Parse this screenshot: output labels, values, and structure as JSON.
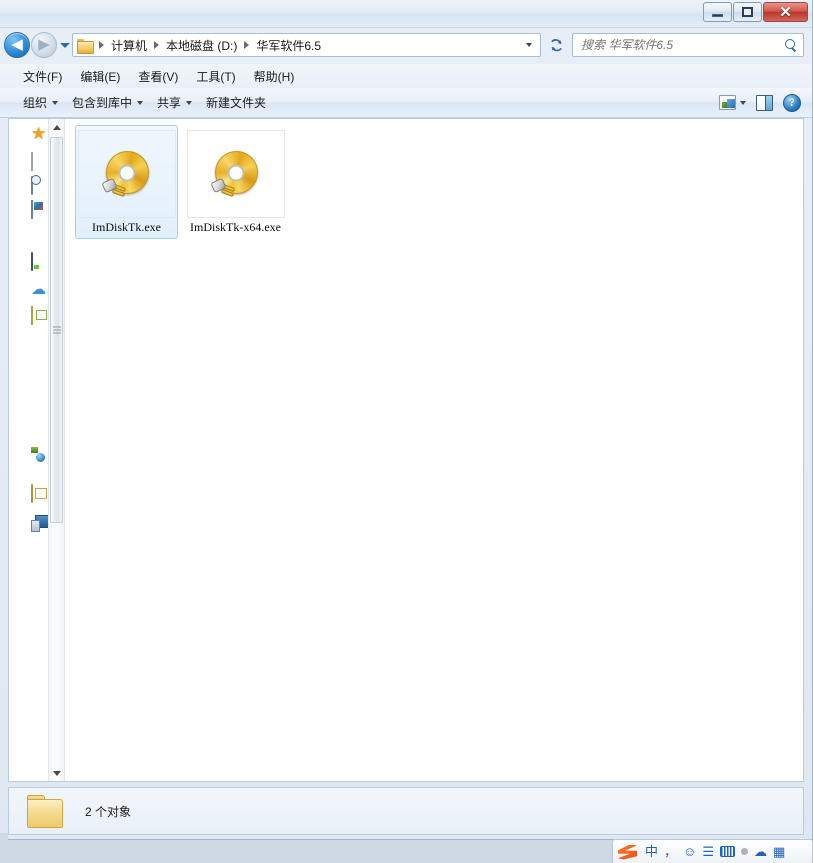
{
  "window": {
    "controls": {
      "minimize_label": "–",
      "maximize_label": "□",
      "close_label": "✕"
    }
  },
  "address_bar": {
    "back_label": "◀",
    "forward_label": "▶",
    "recent_pages_label": "▼",
    "folder_icon": "folder-icon",
    "breadcrumbs": [
      {
        "label": "计算机"
      },
      {
        "label": "本地磁盘 (D:)"
      },
      {
        "label": "华军软件6.5"
      }
    ],
    "dropdown_label": "▼",
    "refresh_label": "↻",
    "search": {
      "placeholder": "搜索 华军软件6.5",
      "value": "",
      "icon": "search-icon"
    }
  },
  "menu_bar": {
    "items": [
      {
        "label": "文件(F)"
      },
      {
        "label": "编辑(E)"
      },
      {
        "label": "查看(V)"
      },
      {
        "label": "工具(T)"
      },
      {
        "label": "帮助(H)"
      }
    ]
  },
  "command_bar": {
    "items": [
      {
        "label": "组织",
        "has_arrow": true
      },
      {
        "label": "包含到库中",
        "has_arrow": true
      },
      {
        "label": "共享",
        "has_arrow": true
      },
      {
        "label": "新建文件夹",
        "has_arrow": false
      }
    ],
    "view_button": "change-view-icon",
    "view_dropdown": "▼",
    "preview_button": "preview-pane-icon",
    "help_button": "?"
  },
  "nav_pane": {
    "icons": [
      {
        "name": "favorites-star-icon"
      },
      {
        "name": "desktop-item-icon"
      },
      {
        "name": "recent-places-icon"
      },
      {
        "name": "downloads-icon"
      },
      {
        "name": "computer-desktop-icon"
      },
      {
        "name": "skydrive-icon"
      },
      {
        "name": "libraries-icon"
      },
      {
        "name": "network-icon"
      },
      {
        "name": "folder-item-icon"
      },
      {
        "name": "computer-item-icon"
      }
    ],
    "scrollbar": {
      "up_arrow": "▲",
      "down_arrow": "▼"
    }
  },
  "content": {
    "files": [
      {
        "name": "ImDiskTk.exe",
        "icon": "disc-installer-icon",
        "selected": true
      },
      {
        "name": "ImDiskTk-x64.exe",
        "icon": "disc-installer-icon",
        "selected": false
      }
    ]
  },
  "status_bar": {
    "folder_icon": "folder-icon",
    "text": "2 个对象"
  },
  "ime_bar": {
    "logo": "sogou-ime-logo",
    "items": [
      {
        "label": "中",
        "name": "ime-chinese-mode"
      },
      {
        "label": "，",
        "name": "ime-punctuation-mode"
      },
      {
        "label": "☺",
        "name": "ime-emoji"
      },
      {
        "label": "☰",
        "name": "ime-toolbox"
      },
      {
        "label": "",
        "name": "ime-keyboard"
      },
      {
        "label": "",
        "name": "ime-status-dot"
      },
      {
        "label": "☁",
        "name": "ime-cloud"
      },
      {
        "label": "▦",
        "name": "ime-menu"
      }
    ]
  },
  "colors": {
    "accent": "#2f6ca8",
    "close_button": "#b8372b",
    "selection": "#a8cfe8",
    "disc_gold": "#e9b02a"
  }
}
